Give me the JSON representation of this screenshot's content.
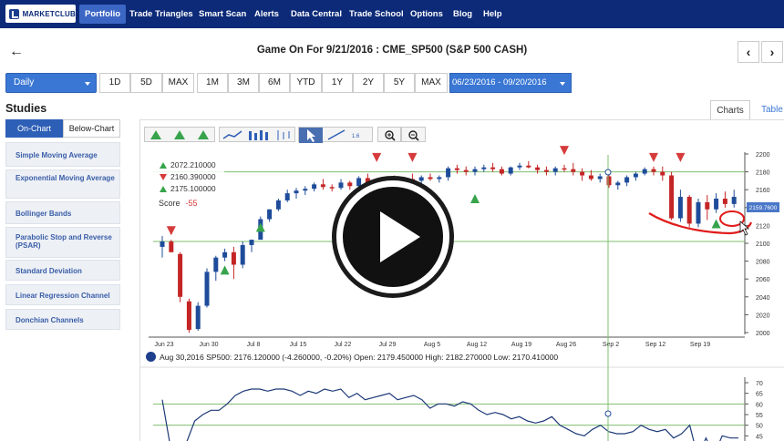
{
  "nav": {
    "logo": "MARKETCLUB",
    "items": [
      "Portfolio",
      "Trade Triangles",
      "Smart Scan",
      "Alerts",
      "Data Central",
      "Trade School",
      "Options",
      "Blog",
      "Help"
    ]
  },
  "header": {
    "title": "Game On For 9/21/2016 : CME_SP500 (S&P 500 CASH)"
  },
  "range": {
    "interval": "Daily",
    "buttons": [
      "1D",
      "5D",
      "MAX",
      "1M",
      "3M",
      "6M",
      "YTD",
      "1Y",
      "2Y",
      "5Y",
      "MAX"
    ],
    "date_range": "06/23/2016 - 09/20/2016"
  },
  "studies": {
    "title": "Studies",
    "tabs": [
      "On-Chart",
      "Below-Chart"
    ],
    "items": [
      "Simple Moving Average",
      "Exponential Moving Average",
      "Bollinger Bands",
      "Parabolic Stop and Reverse (PSAR)",
      "Standard Deviation",
      "Linear Regression Channel",
      "Donchian Channels"
    ]
  },
  "chart_tabs": [
    "Charts",
    "Table"
  ],
  "legend": {
    "rows": [
      {
        "dir": "up",
        "value": "2072.210000"
      },
      {
        "dir": "down",
        "value": "2160.390000"
      },
      {
        "dir": "up",
        "value": "2175.100000"
      }
    ],
    "score_label": "Score",
    "score_value": "-55"
  },
  "price_label": "2159.7600",
  "info_line": "Aug 30,2016 SP500: 2176.120000 (-4.260000, -0.20%) Open: 2179.450000 High: 2182.270000 Low: 2170.410000",
  "colors": {
    "nav_bg": "#0c2a78",
    "accent": "#3a77d4",
    "up_triangle": "#37a44c",
    "down_triangle": "#d63b3b",
    "candle_up": "#1e4c9a",
    "candle_down": "#c42525",
    "annotation": "#e01c1c"
  },
  "chart_data": [
    {
      "type": "candlestick",
      "x_ticks": [
        "Jun 23",
        "Jun 30",
        "Jul 8",
        "Jul 15",
        "Jul 22",
        "Jul 29",
        "Aug 5",
        "Aug 12",
        "Aug 19",
        "Aug 26",
        "Sep 2",
        "Sep 12",
        "Sep 19"
      ],
      "y_ticks": [
        2000,
        2020,
        2040,
        2060,
        2080,
        2100,
        2120,
        2140,
        2160,
        2180,
        2200
      ],
      "ylim": [
        2000,
        2200
      ],
      "ohlc": [
        [
          2096,
          2108,
          2084,
          2102
        ],
        [
          2102,
          2104,
          2090,
          2090
        ],
        [
          2088,
          2090,
          2034,
          2040
        ],
        [
          2035,
          2038,
          2000,
          2003
        ],
        [
          2004,
          2034,
          2002,
          2030
        ],
        [
          2030,
          2072,
          2028,
          2068
        ],
        [
          2068,
          2086,
          2058,
          2084
        ],
        [
          2084,
          2094,
          2080,
          2090
        ],
        [
          2090,
          2096,
          2060,
          2076
        ],
        [
          2076,
          2102,
          2072,
          2098
        ],
        [
          2098,
          2104,
          2090,
          2104
        ],
        [
          2104,
          2130,
          2104,
          2127
        ],
        [
          2127,
          2138,
          2124,
          2138
        ],
        [
          2138,
          2150,
          2136,
          2148
        ],
        [
          2148,
          2160,
          2146,
          2156
        ],
        [
          2156,
          2162,
          2150,
          2159
        ],
        [
          2159,
          2164,
          2154,
          2161
        ],
        [
          2161,
          2168,
          2158,
          2166
        ],
        [
          2166,
          2172,
          2160,
          2163
        ],
        [
          2163,
          2166,
          2158,
          2162
        ],
        [
          2162,
          2172,
          2160,
          2168
        ],
        [
          2168,
          2170,
          2160,
          2164
        ],
        [
          2164,
          2175,
          2162,
          2173
        ],
        [
          2173,
          2178,
          2165,
          2168
        ],
        [
          2168,
          2172,
          2160,
          2162
        ],
        [
          2162,
          2174,
          2160,
          2170
        ],
        [
          2170,
          2176,
          2164,
          2168
        ],
        [
          2168,
          2174,
          2162,
          2172
        ],
        [
          2172,
          2178,
          2168,
          2170
        ],
        [
          2170,
          2176,
          2166,
          2174
        ],
        [
          2174,
          2178,
          2170,
          2172
        ],
        [
          2172,
          2176,
          2168,
          2174
        ],
        [
          2174,
          2186,
          2170,
          2184
        ],
        [
          2184,
          2188,
          2178,
          2182
        ],
        [
          2182,
          2186,
          2176,
          2180
        ],
        [
          2180,
          2186,
          2176,
          2183
        ],
        [
          2183,
          2188,
          2180,
          2185
        ],
        [
          2185,
          2190,
          2180,
          2183
        ],
        [
          2183,
          2186,
          2176,
          2178
        ],
        [
          2178,
          2186,
          2176,
          2185
        ],
        [
          2185,
          2190,
          2182,
          2187
        ],
        [
          2187,
          2192,
          2184,
          2185
        ],
        [
          2185,
          2188,
          2178,
          2182
        ],
        [
          2182,
          2186,
          2176,
          2180
        ],
        [
          2180,
          2186,
          2176,
          2184
        ],
        [
          2184,
          2188,
          2180,
          2183
        ],
        [
          2183,
          2190,
          2176,
          2180
        ],
        [
          2180,
          2184,
          2170,
          2176
        ],
        [
          2176,
          2182,
          2170,
          2172
        ],
        [
          2172,
          2178,
          2168,
          2175
        ],
        [
          2175,
          2178,
          2162,
          2165
        ],
        [
          2165,
          2170,
          2160,
          2168
        ],
        [
          2168,
          2176,
          2164,
          2174
        ],
        [
          2174,
          2180,
          2170,
          2178
        ],
        [
          2178,
          2185,
          2176,
          2183
        ],
        [
          2183,
          2186,
          2176,
          2180
        ],
        [
          2180,
          2186,
          2170,
          2176
        ],
        [
          2176,
          2180,
          2126,
          2128
        ],
        [
          2128,
          2160,
          2124,
          2152
        ],
        [
          2152,
          2154,
          2118,
          2122
        ],
        [
          2122,
          2150,
          2118,
          2146
        ],
        [
          2146,
          2154,
          2126,
          2138
        ],
        [
          2138,
          2156,
          2134,
          2150
        ],
        [
          2150,
          2158,
          2140,
          2144
        ],
        [
          2144,
          2160,
          2140,
          2152
        ]
      ],
      "horizontal_levels": [
        2180,
        2102
      ]
    },
    {
      "type": "line",
      "y_ticks": [
        40,
        45,
        50,
        55,
        60,
        65,
        70
      ],
      "ylim": [
        40,
        70
      ],
      "values": [
        62,
        40,
        35,
        42,
        52,
        55,
        57,
        57,
        60,
        64,
        66,
        67,
        67,
        66,
        67,
        67,
        66,
        64,
        66,
        65,
        67,
        66,
        67,
        63,
        65,
        62,
        63,
        64,
        65,
        62,
        63,
        64,
        62,
        58,
        60,
        60,
        59,
        61,
        60,
        57,
        55,
        56,
        55,
        53,
        54,
        52,
        51,
        52,
        54,
        50,
        48,
        46,
        45,
        48,
        50,
        47,
        46,
        46,
        47,
        50,
        48,
        47,
        48,
        44,
        46,
        50,
        35,
        44,
        36,
        45,
        44,
        44
      ]
    }
  ]
}
